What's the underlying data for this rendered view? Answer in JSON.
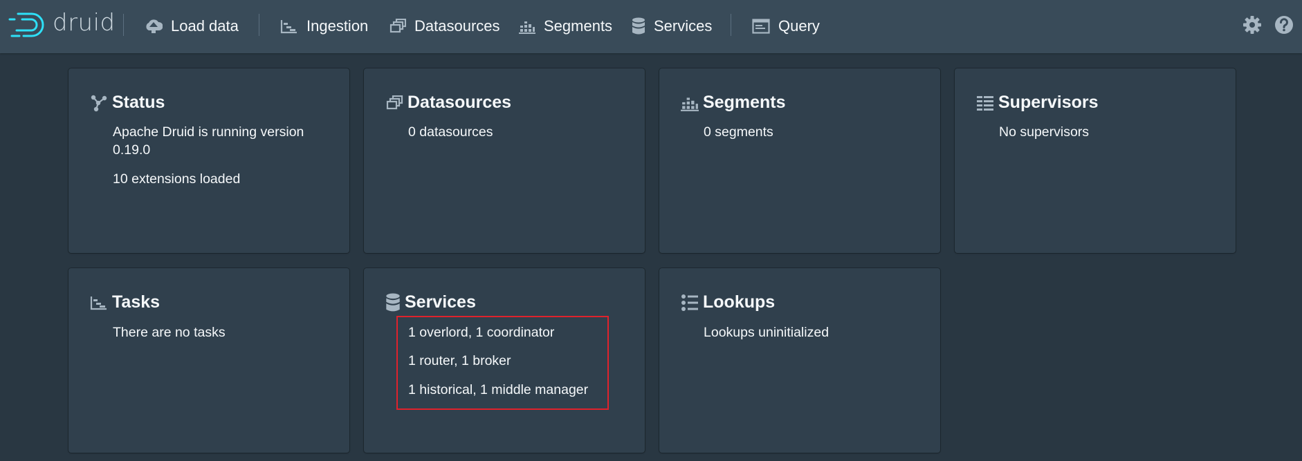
{
  "app": {
    "logo_text": "druid"
  },
  "nav": {
    "load_data": "Load data",
    "ingestion": "Ingestion",
    "datasources": "Datasources",
    "segments": "Segments",
    "services": "Services",
    "query": "Query"
  },
  "cards": {
    "status": {
      "title": "Status",
      "line1": "Apache Druid is running version",
      "line2": "0.19.0",
      "line3": "10 extensions loaded"
    },
    "datasources": {
      "title": "Datasources",
      "line1": "0 datasources"
    },
    "segments": {
      "title": "Segments",
      "line1": "0 segments"
    },
    "supervisors": {
      "title": "Supervisors",
      "line1": "No supervisors"
    },
    "tasks": {
      "title": "Tasks",
      "line1": "There are no tasks"
    },
    "services": {
      "title": "Services",
      "line1": "1 overlord, 1 coordinator",
      "line2": "1 router, 1 broker",
      "line3": "1 historical, 1 middle manager"
    },
    "lookups": {
      "title": "Lookups",
      "line1": "Lookups uninitialized"
    }
  },
  "colors": {
    "background": "#293742",
    "navbar": "#394b59",
    "card": "#30404d",
    "logo_accent": "#2ee0f7",
    "icon": "#a7b6c2",
    "highlight": "#e0222c"
  },
  "icons": {
    "logo": "druid-logo-icon",
    "load_data": "cloud-upload-icon",
    "ingestion": "gantt-chart-icon",
    "datasources": "multi-select-icon",
    "segments": "stacked-chart-icon",
    "services": "database-icon",
    "query": "application-icon",
    "settings": "cog-icon",
    "help": "help-icon",
    "status": "graph-icon",
    "supervisors": "list-columns-icon",
    "lookups": "properties-icon"
  }
}
